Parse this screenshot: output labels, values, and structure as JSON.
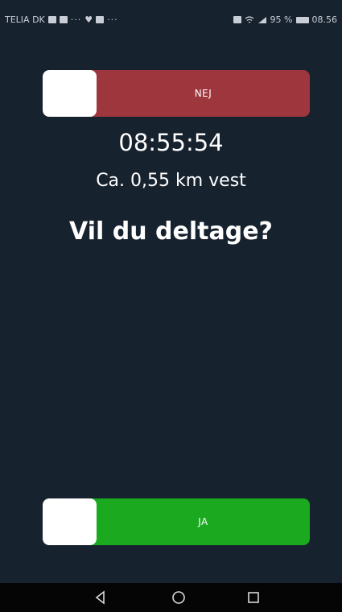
{
  "statusbar": {
    "carrier": "TELIA DK",
    "battery_percent": "95 %",
    "time": "08.56",
    "icons": [
      "image-icon",
      "mail-icon",
      "heart-icon",
      "notification-icon",
      "nfc-icon",
      "wifi-icon",
      "signal-icon",
      "battery-icon"
    ]
  },
  "slider_no": {
    "label": "NEJ",
    "color": "#9e363d"
  },
  "main": {
    "time": "08:55:54",
    "distance": "Ca. 0,55 km vest",
    "question": "Vil du deltage?"
  },
  "slider_yes": {
    "label": "JA",
    "color": "#1aa91f"
  },
  "navbar": {
    "buttons": [
      "back-icon",
      "home-icon",
      "recents-icon"
    ]
  },
  "colors": {
    "background": "#17222f",
    "navbar": "#050505"
  }
}
